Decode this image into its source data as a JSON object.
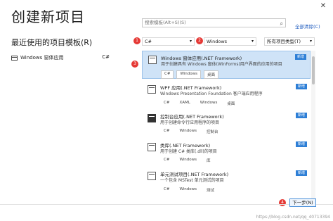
{
  "window": {
    "title": "创建新项目",
    "close_glyph": "✕"
  },
  "recent": {
    "label": "最近使用的项目模板(R)",
    "items": [
      {
        "name": "Windows 窗体应用",
        "lang": "C#"
      }
    ]
  },
  "search": {
    "placeholder": "搜索模板(Alt+S)(S)",
    "clear_all": "全部清除(C)"
  },
  "filters": {
    "language": "C#",
    "platform": "Windows",
    "project_type": "所有项目类型(T)"
  },
  "markers": [
    "1",
    "2",
    "3",
    "4"
  ],
  "templates": [
    {
      "name": "Windows 窗体应用(.NET Framework)",
      "desc": "用于创建具有 Windows 窗体(WinForms)用户界面的应用的项目",
      "badge": "新增",
      "tags": [
        "C#",
        "Windows",
        "桌面"
      ],
      "icon": "winforms-icon",
      "selected": true
    },
    {
      "name": "WPF 应用(.NET Framework)",
      "desc": "Windows Presentation Foundation 客户端应用程序",
      "badge": "新增",
      "tags": [
        "C#",
        "XAML",
        "Windows",
        "桌面"
      ],
      "icon": "wpf-icon"
    },
    {
      "name": "控制台应用(.NET Framework)",
      "desc": "用于创建命令行应用程序的项目",
      "badge": "新增",
      "tags": [
        "C#",
        "Windows",
        "控制台"
      ],
      "icon": "console-icon"
    },
    {
      "name": "类库(.NET Framework)",
      "desc": "用于创建 C# 类库(.dll)的项目",
      "badge": "新增",
      "tags": [
        "C#",
        "Windows",
        "库"
      ],
      "icon": "class-library-icon"
    },
    {
      "name": "单元测试项目(.NET Framework)",
      "desc": "一个包含 MSTest 单元测试的项目",
      "badge": "新增",
      "tags": [
        "C#",
        "Windows",
        "测试"
      ],
      "icon": "unit-test-icon"
    }
  ],
  "footer": {
    "next_label": "下一步(N)",
    "watermark": "https://blog.csdn.net/qq_40713394"
  }
}
